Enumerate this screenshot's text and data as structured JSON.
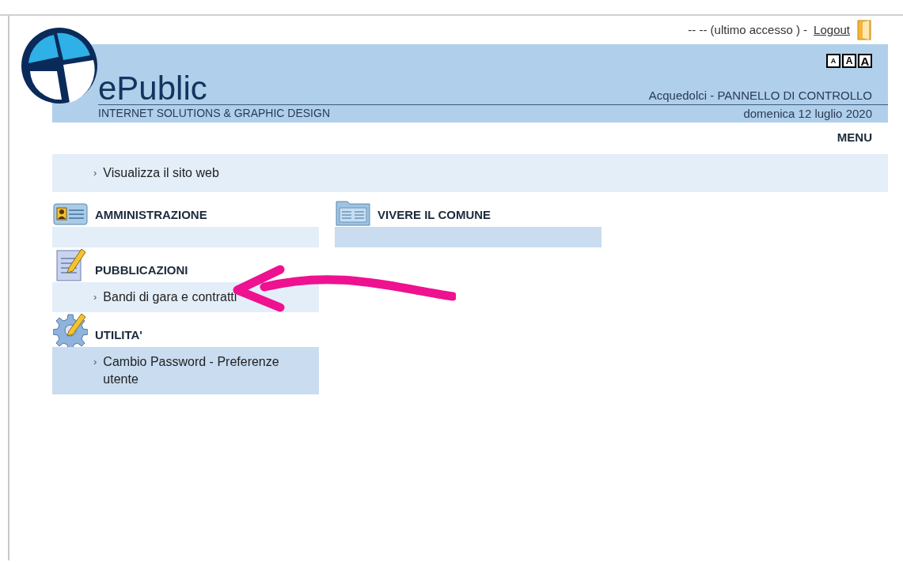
{
  "header": {
    "brand": "ePublic",
    "tagline": "INTERNET SOLUTIONS & GRAPHIC DESIGN",
    "last_access": "-- -- (ultimo accesso ) -",
    "logout": "Logout",
    "font_sizes": [
      "A",
      "A",
      "A"
    ],
    "title": "Acquedolci - PANNELLO DI CONTROLLO",
    "date": "domenica 12 luglio 2020"
  },
  "menu_label": "MENU",
  "site_link": {
    "marker": "›",
    "label": "Visualizza il sito web"
  },
  "section_rows": [
    [
      {
        "title": "AMMINISTRAZIONE",
        "kind": "id-card",
        "color": "#e4eef9"
      },
      {
        "title": "VIVERE IL COMUNE",
        "kind": "folder",
        "color": "#c9dcf0"
      }
    ],
    [
      {
        "title": "PUBBLICAZIONI",
        "kind": "notepad",
        "color": "#e4eef9",
        "links": [
          {
            "marker": "›",
            "label": "Bandi di gara e contratti"
          }
        ]
      }
    ],
    [
      {
        "title": "UTILITA'",
        "kind": "gear",
        "color": "#c9dcf0",
        "links": [
          {
            "marker": "›",
            "label": "Cambio Password - Preferenze utente"
          }
        ]
      }
    ]
  ],
  "annotation": {
    "kind": "arrow"
  }
}
